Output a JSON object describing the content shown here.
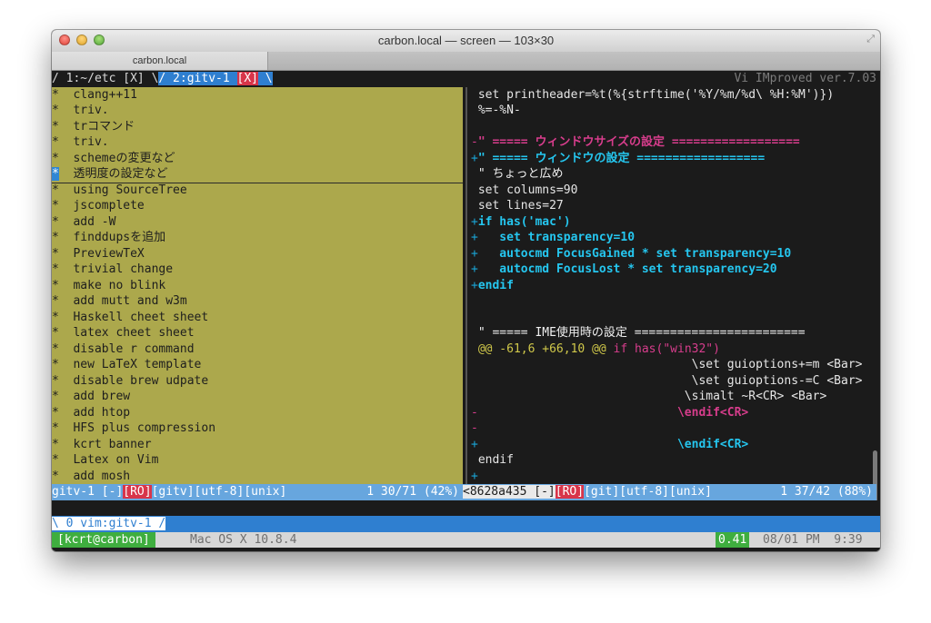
{
  "window": {
    "title": "carbon.local — screen — 103×30",
    "tab_label": "carbon.local"
  },
  "screen_tabline": {
    "win1": "/ 1:~/etc [X] \\",
    "win2": "/ 2:gitv-1 ",
    "win2_close": "[X]",
    "win2_end": " \\",
    "vim_version": "Vi IMproved ver.7.03"
  },
  "commits": [
    "clang++11",
    "triv.",
    "trコマンド",
    "triv.",
    "schemeの変更など",
    "透明度の設定など",
    "using SourceTree",
    "jscomplete",
    "add -W",
    "finddupsを追加",
    "PreviewTeX",
    "trivial change",
    "make no blink",
    "add mutt and w3m",
    "Haskell cheet sheet",
    "latex cheet sheet",
    "disable r command",
    "new LaTeX template",
    "disable brew udpate",
    "add brew",
    "add htop",
    "HFS plus compression",
    "kcrt banner",
    "Latex on Vim",
    "add mosh"
  ],
  "commit_bullet": "*",
  "diff_lines": [
    {
      "sign": " ",
      "text": "set printheader=%t(%{strftime('%Y/%m/%d\\ %H:%M')})",
      "style": "plain"
    },
    {
      "sign": "",
      "text": "%=-%N-",
      "style": "plain"
    },
    {
      "sign": "",
      "text": "",
      "style": "plain"
    },
    {
      "sign": "-",
      "text": "\" ===== ウィンドウサイズの設定 ==================",
      "style": "pink"
    },
    {
      "sign": "+",
      "text": "\" ===== ウィンドウの設定 ==================",
      "style": "cyan"
    },
    {
      "sign": " ",
      "text": "\" ちょっと広め",
      "style": "white"
    },
    {
      "sign": " ",
      "text": "set columns=90",
      "style": "plain"
    },
    {
      "sign": " ",
      "text": "set lines=27",
      "style": "plain"
    },
    {
      "sign": "+",
      "text": "if has('mac')",
      "style": "cyan"
    },
    {
      "sign": "+",
      "text": "   set transparency=10",
      "style": "cyan"
    },
    {
      "sign": "+",
      "text": "   autocmd FocusGained * set transparency=10",
      "style": "cyan"
    },
    {
      "sign": "+",
      "text": "   autocmd FocusLost * set transparency=20",
      "style": "cyan"
    },
    {
      "sign": "+",
      "text": "endif",
      "style": "cyan"
    },
    {
      "sign": "",
      "text": "",
      "style": "plain"
    },
    {
      "sign": "",
      "text": "",
      "style": "plain"
    },
    {
      "sign": " ",
      "text": "\" ===== IME使用時の設定 ========================",
      "style": "white"
    },
    {
      "sign": "",
      "text": "@@ -61,6 +66,10 @@ if has(\"win32\")",
      "style": "hunk"
    },
    {
      "sign": "",
      "text": "                              \\set guioptions+=m <Bar>",
      "style": "plain"
    },
    {
      "sign": "",
      "text": "                              \\set guioptions-=C <Bar>",
      "style": "plain"
    },
    {
      "sign": "",
      "text": "                             \\simalt ~R<CR> <Bar>",
      "style": "plain"
    },
    {
      "sign": "-",
      "text": "                            \\endif<CR>",
      "style": "pink"
    },
    {
      "sign": "-",
      "text": "",
      "style": "pink"
    },
    {
      "sign": "+",
      "text": "                            \\endif<CR>",
      "style": "cyan"
    },
    {
      "sign": " ",
      "text": "endif",
      "style": "plain"
    },
    {
      "sign": "+",
      "text": "",
      "style": "cyan"
    }
  ],
  "status_left": {
    "name": "gitv-1 [-]",
    "ro": "[RO]",
    "rest": "[gitv][utf-8][unix]",
    "pos": "1 30/71 (42%)"
  },
  "status_right": {
    "name": "<8628a435 [-]",
    "ro": "[RO]",
    "rest": "[git][utf-8][unix]",
    "pos": "1 37/42 (88%)"
  },
  "screen_bar": {
    "label": "\\ 0 vim:gitv-1 /"
  },
  "hardstatus": {
    "host": "[kcrt@carbon]",
    "os": "Mac OS X 10.8.4",
    "load": "0.41",
    "time": "08/01 PM  9:39"
  },
  "colors": {
    "pane_bg": "#aca84c",
    "accent_blue": "#2f7fd0",
    "diff_add": "#25c6ef",
    "diff_del": "#d73d8c",
    "readonly": "#d8354a",
    "host_green": "#3fae3f"
  }
}
